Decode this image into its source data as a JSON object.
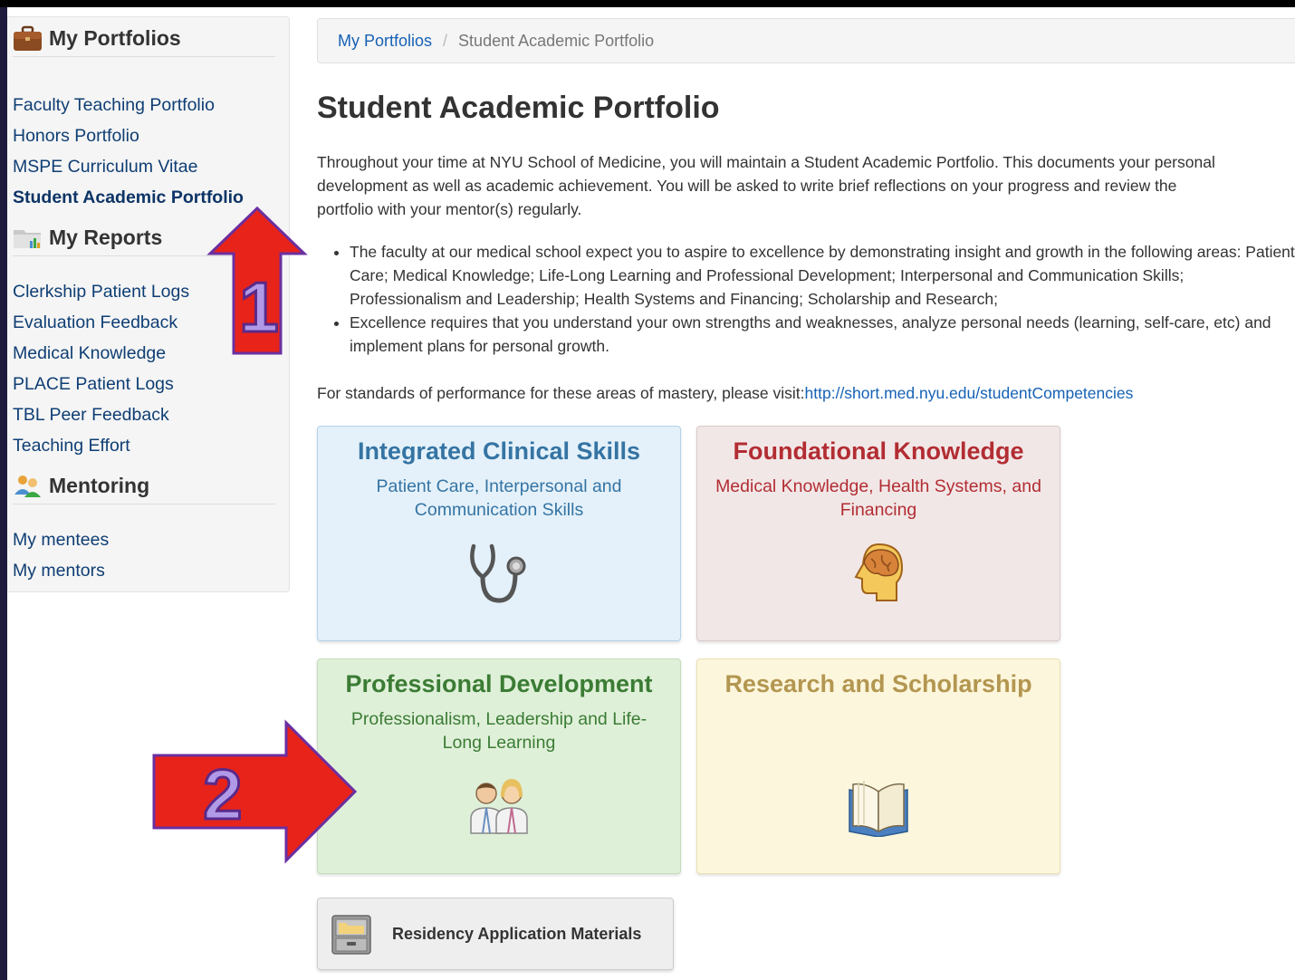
{
  "sidebar": {
    "portfolios": {
      "header": "My Portfolios",
      "icon": "briefcase-icon",
      "items": [
        {
          "label": "Faculty Teaching Portfolio",
          "active": false
        },
        {
          "label": "Honors Portfolio",
          "active": false
        },
        {
          "label": "MSPE Curriculum Vitae",
          "active": false
        },
        {
          "label": "Student Academic Portfolio",
          "active": true
        }
      ]
    },
    "reports": {
      "header": "My Reports",
      "icon": "folder-chart-icon",
      "items": [
        {
          "label": "Clerkship Patient Logs"
        },
        {
          "label": "Evaluation Feedback"
        },
        {
          "label": "Medical Knowledge"
        },
        {
          "label": "PLACE Patient Logs"
        },
        {
          "label": "TBL Peer Feedback"
        },
        {
          "label": "Teaching Effort"
        }
      ]
    },
    "mentoring": {
      "header": "Mentoring",
      "icon": "people-icon",
      "items": [
        {
          "label": "My mentees"
        },
        {
          "label": "My mentors"
        }
      ]
    }
  },
  "breadcrumb": {
    "parent": "My Portfolios",
    "separator": "/",
    "current": "Student Academic Portfolio"
  },
  "main": {
    "title": "Student Academic Portfolio",
    "intro": "Throughout your time at NYU School of Medicine, you will maintain a Student Academic Portfolio. This documents your personal development as well as academic achievement. You will be asked to write brief reflections on your progress and review the portfolio with your mentor(s) regularly.",
    "bullets": [
      "The faculty at our medical school expect you to aspire to excellence by demonstrating insight and growth in the following areas: Patient Care; Medical Knowledge; Life-Long Learning and Professional Development; Interpersonal and Communication Skills; Professionalism and Leadership; Health Systems and Financing; Scholarship and Research;",
      "Excellence requires that you understand your own strengths and weaknesses, analyze personal needs (learning, self-care, etc) and implement plans for personal growth."
    ],
    "standards_text": "For standards of performance for these areas of mastery, please visit:",
    "standards_link": "http://short.med.nyu.edu/studentCompetencies"
  },
  "tiles": {
    "clinical": {
      "title": "Integrated Clinical Skills",
      "subtitle": "Patient Care, Interpersonal and Communication Skills",
      "icon": "stethoscope-icon",
      "color": "#3574a3"
    },
    "knowledge": {
      "title": "Foundational Knowledge",
      "subtitle": "Medical Knowledge, Health Systems, and Financing",
      "icon": "brain-head-icon",
      "color": "#b22d33"
    },
    "professional": {
      "title": "Professional Development",
      "subtitle": "Professionalism, Leadership and Life-Long Learning",
      "icon": "doctors-icon",
      "color": "#3b7c34"
    },
    "research": {
      "title": "Research and Scholarship",
      "subtitle": "",
      "icon": "open-book-icon",
      "color": "#b39650"
    }
  },
  "residency_button": {
    "label": "Residency Application Materials",
    "icon": "file-cabinet-icon"
  },
  "annotations": {
    "arrow1_label": "1",
    "arrow2_label": "2",
    "arrow_color": "#e8231a"
  }
}
